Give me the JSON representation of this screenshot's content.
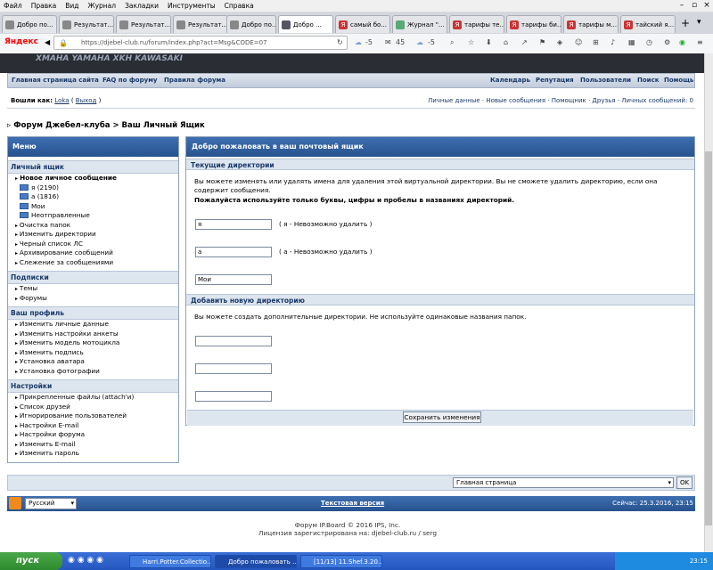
{
  "menubar": [
    "Файл",
    "Правка",
    "Вид",
    "Журнал",
    "Закладки",
    "Инструменты",
    "Справка"
  ],
  "window_controls": [
    "–",
    "▫",
    "×"
  ],
  "tabs": [
    {
      "label": "Добро по..."
    },
    {
      "label": "Результат..."
    },
    {
      "label": "Результат..."
    },
    {
      "label": "Результат..."
    },
    {
      "label": "Добро по..."
    },
    {
      "label": "Добро ...",
      "active": true
    },
    {
      "label": "самый бо..."
    },
    {
      "label": "Журнал \"..."
    },
    {
      "label": "тарифы те..."
    },
    {
      "label": "тарифы би..."
    },
    {
      "label": "тарифы м..."
    },
    {
      "label": "тайский я..."
    }
  ],
  "address": {
    "logo": "Яндекс",
    "url": "https://djebel-club.ru/forum/index.php?act=Msg&CODE=07",
    "weather1": "-5",
    "mail_count": "45",
    "weather2": "-5"
  },
  "site": {
    "banner_text": "XMAHA  YAMAHA  XKH  KAWASAKI",
    "nav_left": [
      "Главная страница сайта",
      "FAQ по форуму",
      "Правила форума"
    ],
    "nav_right": [
      "Календарь",
      "Репутация",
      "Пользователи",
      "Поиск",
      "Помощь"
    ],
    "logged_in_label": "Вошли как:",
    "user": "Loka",
    "logout": "Выход",
    "user_links": "Личные данные · Новые сообщения · Помощник · Друзья · Личных сообщений: 0",
    "breadcrumb": "Форум Джебел-клуба > Ваш Личный Ящик"
  },
  "sidebar": {
    "title": "Меню",
    "sections": [
      {
        "title": "Личный ящик",
        "new_msg": "Новое личное сообщение",
        "folders": [
          "я (2190)",
          "а (1816)",
          "Мои",
          "Неотправленные"
        ],
        "items": [
          "Очистка папок",
          "Изменить директории",
          "Черный список ЛС",
          "Архивирование сообщений",
          "Слежение за сообщениями"
        ]
      },
      {
        "title": "Подписки",
        "items": [
          "Темы",
          "Форумы"
        ]
      },
      {
        "title": "Ваш профиль",
        "items": [
          "Изменить личные данные",
          "Изменить настройки анкеты",
          "Изменить модель мотоцикла",
          "Изменить подпись",
          "Установка аватара",
          "Установка фотографии"
        ]
      },
      {
        "title": "Настройки",
        "items": [
          "Прикрепленные файлы (attach'и)",
          "Список друзей",
          "Игнорирование пользователей",
          "Настройки E-mail",
          "Настройки форума",
          "Изменить E-mail",
          "Изменить пароль"
        ]
      }
    ]
  },
  "main": {
    "title": "Добро пожаловать в ваш почтовый ящик",
    "current_dirs": "Текущие директории",
    "current_text": "Вы можете изменять или удалять имена для удаления этой виртуальной директории. Вы не сможете удалить директорию, если она содержит сообщения.",
    "current_bold": "Пожалуйста используйте только буквы, цифры и пробелы в названиях директорий.",
    "dirs": [
      {
        "value": "я",
        "note": "( я - Невозможно удалить )"
      },
      {
        "value": "а",
        "note": "( а - Невозможно удалить )"
      },
      {
        "value": "Мои",
        "note": ""
      }
    ],
    "add_title": "Добавить новую директорию",
    "add_text": "Вы можете создать дополнительные директории. Не используйте одинаковые названия папок.",
    "save_label": "Сохранить изменения"
  },
  "bottom": {
    "jump_value": "Главная страница",
    "ok": "OK",
    "language": "Русский",
    "text_version": "Текстовая версия",
    "now": "Сейчас: 25.3.2016, 23:15",
    "copyright": "Форум IP.Board © 2016  IPS, Inc.",
    "license": "Лицензия зарегистрирована на: djebel-club.ru / serg"
  },
  "taskbar": {
    "start": "пуск",
    "tasks": [
      "Harri.Potter.Collectio...",
      "Добро пожаловать ...",
      "[11/13] 11.Shef.3.20..."
    ],
    "clock": "23:15"
  }
}
